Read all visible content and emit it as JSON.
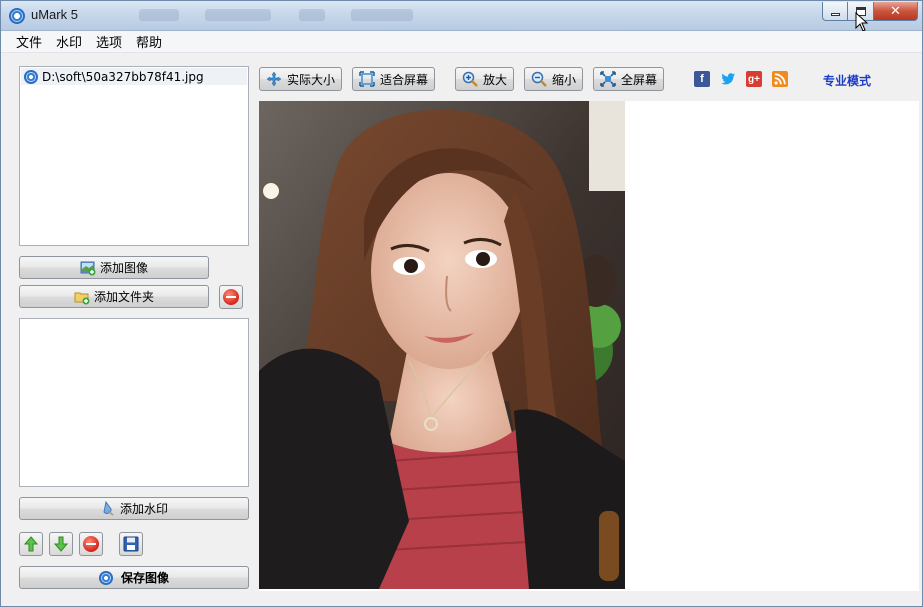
{
  "window": {
    "title": "uMark 5"
  },
  "menu": [
    "文件",
    "水印",
    "选项",
    "帮助"
  ],
  "file_list": {
    "items": [
      {
        "path": "D:\\soft\\50a327bb78f41.jpg"
      }
    ]
  },
  "left_buttons": {
    "add_image": "添加图像",
    "add_folder": "添加文件夹",
    "add_watermark": "添加水印",
    "save_image": "保存图像"
  },
  "toolbar": {
    "actual_size": "实际大小",
    "fit_screen": "适合屏幕",
    "zoom_in": "放大",
    "zoom_out": "缩小",
    "fullscreen": "全屏幕",
    "pro_mode": "专业模式"
  },
  "social": {
    "facebook": "f",
    "google_plus": "g+"
  },
  "colors": {
    "accent": "#1a3cc8",
    "facebook": "#3b5998",
    "twitter": "#1da1f2",
    "google_plus": "#d73d32",
    "rss": "#f28b1d"
  },
  "icons": {
    "app": "umark-logo-icon",
    "actual_size": "move-arrows-icon",
    "fit_screen": "fit-frame-icon",
    "zoom_in": "magnifier-plus-icon",
    "zoom_out": "magnifier-minus-icon",
    "fullscreen": "expand-arrows-icon"
  }
}
